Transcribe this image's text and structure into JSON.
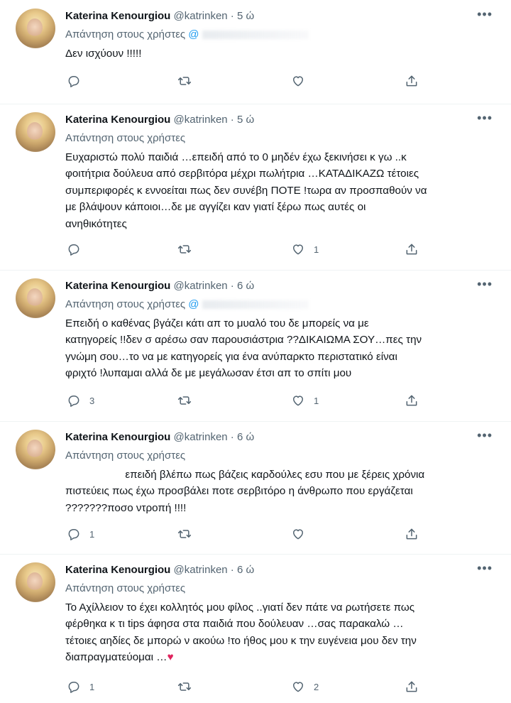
{
  "tweets": [
    {
      "name": "Katerina Kenourgiou",
      "handle": "@katrinken",
      "sep": "·",
      "time": "5 ώ",
      "reply_label": "Απάντηση στους χρήστες",
      "reply_mention": "@",
      "text": "Δεν ισχύουν !!!!!",
      "replies": "",
      "retweets": "",
      "likes": ""
    },
    {
      "name": "Katerina Kenourgiou",
      "handle": "@katrinken",
      "sep": "·",
      "time": "5 ώ",
      "reply_label": "Απάντηση στους χρήστες",
      "reply_mention": "",
      "text": "Ευχαριστώ πολύ παιδιά …επειδή από το 0 μηδέν έχω ξεκινήσει κ γω ..κ\nφοιτήτρια δούλευα από σερβιτόρα μέχρι πωλήτρια …ΚΑΤΑΔΙΚΑΖΩ τέτοιες\nσυμπεριφορές κ εννοείται πως δεν συνέβη ΠΟΤΕ !τωρα αν προσπαθούν να\nμε βλάψουν κάποιοι…δε με αγγίζει καν γιατί ξέρω πως αυτές οι\nανηθικότητες",
      "replies": "",
      "retweets": "",
      "likes": "1"
    },
    {
      "name": "Katerina Kenourgiou",
      "handle": "@katrinken",
      "sep": "·",
      "time": "6 ώ",
      "reply_label": "Απάντηση στους χρήστες",
      "reply_mention": "@",
      "text": "Επειδή ο καθένας βγάζει κάτι απ το μυαλό του δε μπορείς να με\nκατηγορείς !!δεν σ αρέσω σαν παρουσιάστρια ??ΔΙΚΑΙΩΜΑ ΣΟΥ…πες την\nγνώμη σου…το να με κατηγορείς για ένα ανύπαρκτο περιστατικό είναι\nφριχτό !λυπαμαι αλλά δε με μεγάλωσαν έτσι απ το σπίτι μου",
      "replies": "3",
      "retweets": "",
      "likes": "1"
    },
    {
      "name": "Katerina Kenourgiou",
      "handle": "@katrinken",
      "sep": "·",
      "time": "6 ώ",
      "reply_label": "Απάντηση στους χρήστες",
      "reply_mention": "",
      "text": "                    επειδή βλέπω πως βάζεις καρδούλες εσυ που με ξέρεις χρόνια\nπιστεύεις πως έχω προσβάλει ποτε σερβιτόρο η άνθρωπο που εργάζεται\n???????ποσο ντροπή !!!!",
      "replies": "1",
      "retweets": "",
      "likes": ""
    },
    {
      "name": "Katerina Kenourgiou",
      "handle": "@katrinken",
      "sep": "·",
      "time": "6 ώ",
      "reply_label": "Απάντηση στους χρήστες",
      "reply_mention": "",
      "text": "Το Αχίλλειον το έχει κολλητός μου φίλος ..γιατί δεν πάτε να ρωτήσετε πως\nφέρθηκα κ τι tips άφησα στα παιδιά που δούλευαν …σας παρακαλώ …\nτέτοιες αηδίες δε μπορώ ν ακούω !το ήθος μου κ την ευγένεια μου δεν την\nδιαπραγματεύομαι …",
      "text_heart": "♥",
      "replies": "1",
      "retweets": "",
      "likes": "2"
    }
  ],
  "icons": {
    "more": "more-horizontal-icon",
    "reply": "reply-bubble-icon",
    "retweet": "retweet-icon",
    "like": "heart-icon",
    "share": "share-upload-icon"
  },
  "colors": {
    "text": "#0f1419",
    "secondary": "#536471",
    "mention": "#1d9bf0",
    "heart": "#e0245e",
    "divider": "#eff3f4"
  }
}
